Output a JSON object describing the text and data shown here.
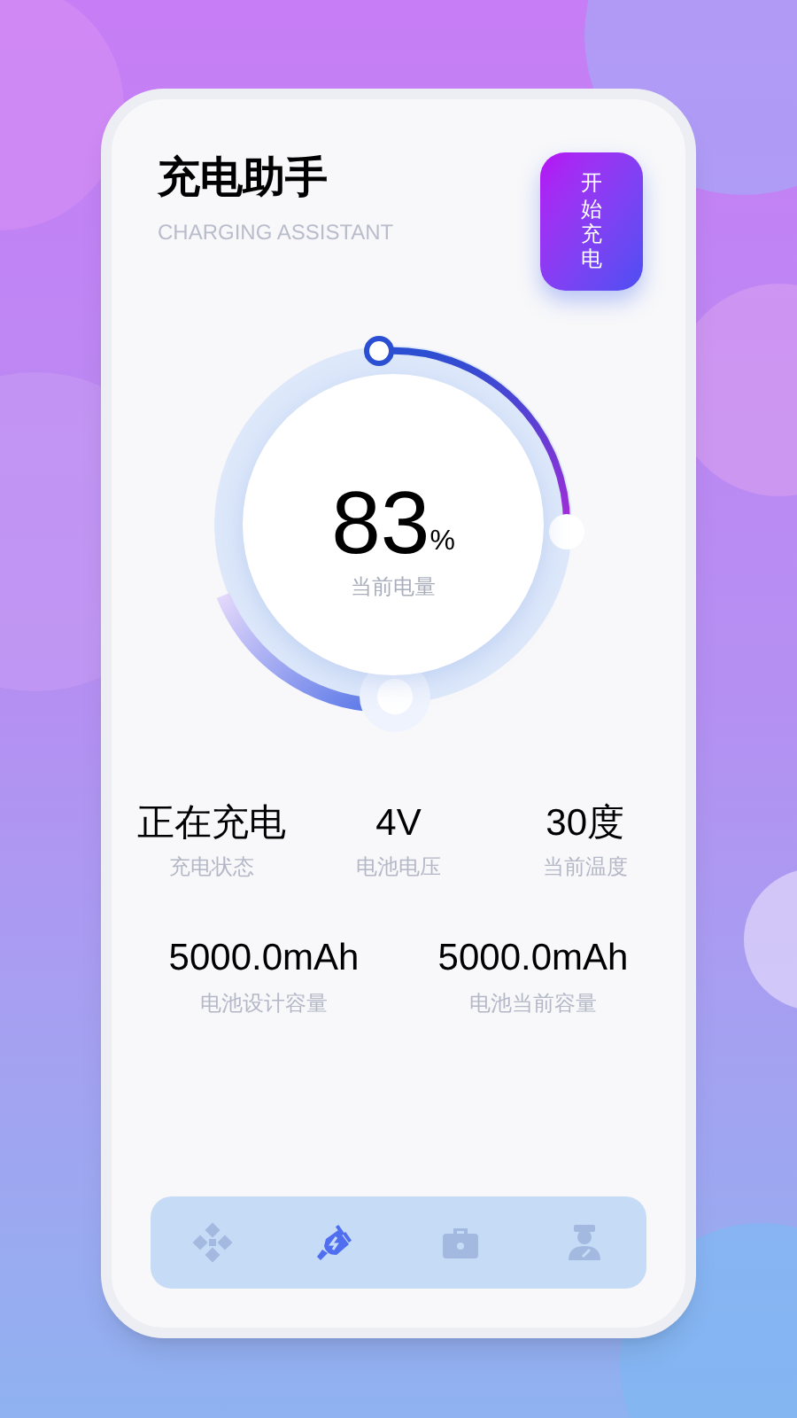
{
  "header": {
    "title": "充电助手",
    "subtitle": "CHARGING ASSISTANT",
    "start_button": "开始充电"
  },
  "battery": {
    "value": "83",
    "unit": "%",
    "label": "当前电量"
  },
  "stats": [
    {
      "value": "正在充电",
      "label": "充电状态"
    },
    {
      "value": "4V",
      "label": "电池电压"
    },
    {
      "value": "30度",
      "label": "当前温度"
    }
  ],
  "capacity": [
    {
      "value": "5000.0mAh",
      "label": "电池设计容量"
    },
    {
      "value": "5000.0mAh",
      "label": "电池当前容量"
    }
  ],
  "nav": [
    {
      "kind": "move",
      "selected": false
    },
    {
      "kind": "plug",
      "selected": true
    },
    {
      "kind": "toolbox",
      "selected": false
    },
    {
      "kind": "worker",
      "selected": false
    }
  ]
}
